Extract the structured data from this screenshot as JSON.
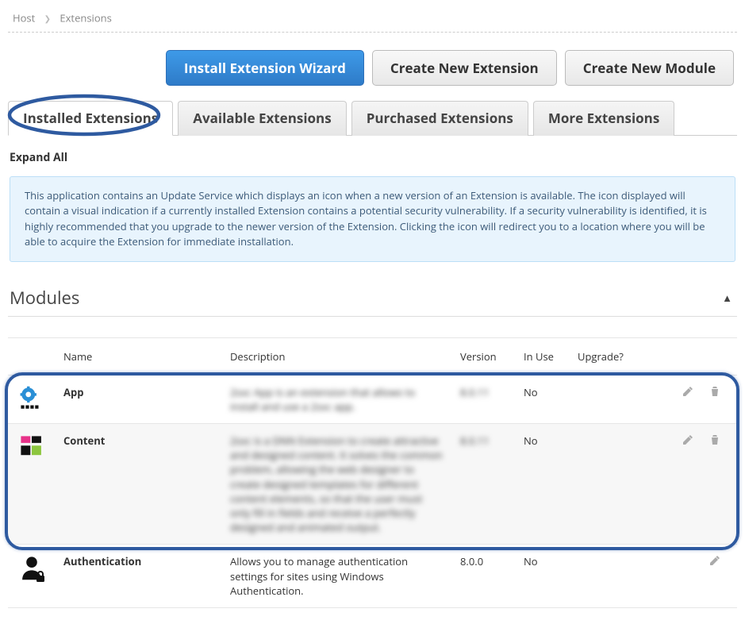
{
  "breadcrumb": {
    "root": "Host",
    "current": "Extensions"
  },
  "buttons": {
    "install": "Install Extension Wizard",
    "newExt": "Create New Extension",
    "newMod": "Create New Module"
  },
  "tabs": [
    {
      "label": "Installed Extensions",
      "active": true
    },
    {
      "label": "Available Extensions",
      "active": false
    },
    {
      "label": "Purchased Extensions",
      "active": false
    },
    {
      "label": "More Extensions",
      "active": false
    }
  ],
  "expandAll": "Expand All",
  "infoText": "This application contains an Update Service which displays an icon when a new version of an Extension is available. The icon displayed will contain a visual indication if a currently installed Extension contains a potential security vulnerability. If a security vulnerability is identified, it is highly recommended that you upgrade to the newer version of the Extension. Clicking the icon will redirect you to a location where you will be able to acquire the Extension for immediate installation.",
  "section": {
    "title": "Modules"
  },
  "columns": {
    "name": "Name",
    "desc": "Description",
    "ver": "Version",
    "use": "In Use",
    "upg": "Upgrade?"
  },
  "rows": [
    {
      "name": "App",
      "descBlur": "2sxc App is an extension that allows to install and use a 2sxc app.",
      "verBlur": "8.0.11",
      "inUse": "No",
      "alt": false,
      "blur": true,
      "editable": true,
      "deletable": true
    },
    {
      "name": "Content",
      "descBlur": "2sxc is a DNN Extension to create attractive and designed content. It solves the common problem, allowing the web designer to create designed templates for different content elements, so that the user must only fill in fields and receive a perfectly designed and animated output.",
      "verBlur": "8.0.11",
      "inUse": "No",
      "alt": true,
      "blur": true,
      "editable": true,
      "deletable": true
    },
    {
      "name": "Authentication",
      "descBlur": "Allows you to manage authentication settings for sites using Windows Authentication.",
      "verBlur": "8.0.0",
      "inUse": "No",
      "alt": false,
      "blur": false,
      "editable": true,
      "deletable": false
    }
  ]
}
